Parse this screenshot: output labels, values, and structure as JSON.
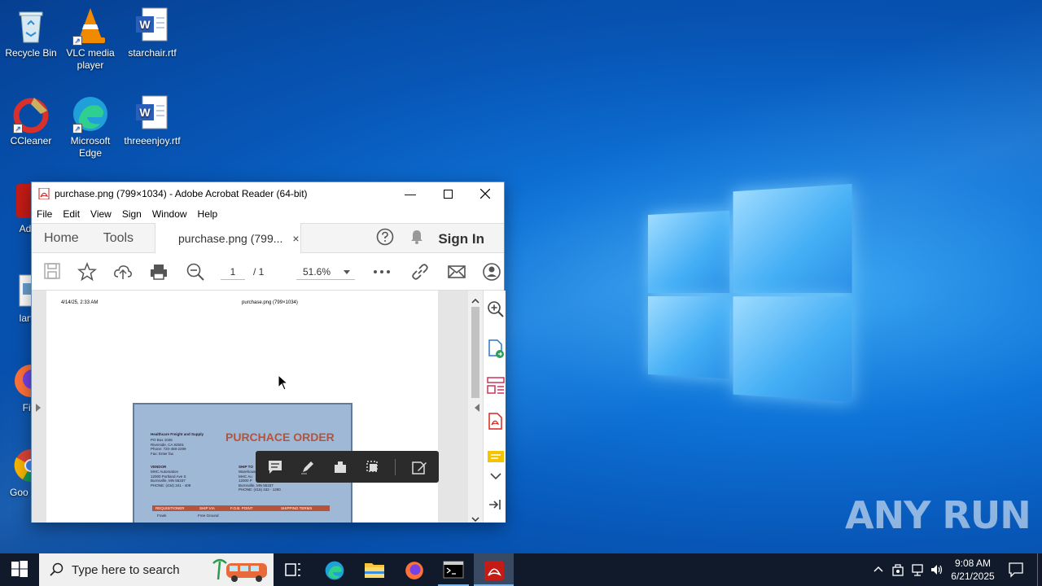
{
  "desktop": {
    "icons": [
      {
        "label": "Recycle Bin"
      },
      {
        "label": "VLC media player"
      },
      {
        "label": "starchair.rtf"
      },
      {
        "label": "CCleaner"
      },
      {
        "label": "Microsoft Edge"
      },
      {
        "label": "threeenjoy.rtf"
      },
      {
        "label": "Ado Acro"
      },
      {
        "label": "lartist"
      },
      {
        "label": "Fire"
      },
      {
        "label": "Goo Chro"
      }
    ],
    "watermark": "ANY RUN"
  },
  "window": {
    "title": "purchase.png (799×1034) - Adobe Acrobat Reader (64-bit)",
    "menu": [
      "File",
      "Edit",
      "View",
      "Sign",
      "Window",
      "Help"
    ],
    "tabs": {
      "home": "Home",
      "tools": "Tools",
      "doc": "purchase.png (799...",
      "close": "×"
    },
    "sign_in": "Sign In",
    "toolbar": {
      "page_current": "1",
      "page_total": "/ 1",
      "zoom": "51.6%"
    },
    "document": {
      "header_left": "4/14/25, 2:33 AM",
      "header_center": "purchase.png (799×1034)",
      "po_title": "PURCHACE ORDER",
      "company": "Healthcare Freight and Supply",
      "company_addr": "PO Box 1026\nRiverside, CA 92501\nPhone: 720-458-2299\nFax: Enter fax",
      "vendor_label": "VENDOR",
      "vendor_addr": "MHC Automation\n12000 Portland Ave S\nBurnsville, MN 55337\nPHONE: (434) 341 - 409",
      "shipto_label": "SHIP TO",
      "shipto_addr": "Warehouse\nMHC Au\n12000 P\nBurnsville, MN 55337\nPHONE: (415) 432 - 1290",
      "table_headers": [
        "REQUISITIONER",
        "SHIP VIA",
        "F.O.B. POINT",
        "SHIPPING TERMS"
      ],
      "table_row": [
        "Frank",
        "Free Ground",
        "",
        ""
      ]
    }
  },
  "taskbar": {
    "search_placeholder": "Type here to search",
    "time": "9:08 AM",
    "date": "6/21/2025"
  },
  "colors": {
    "accent": "#d7261f",
    "po_orange": "#b5533b",
    "taskbar": "#101a2a"
  }
}
